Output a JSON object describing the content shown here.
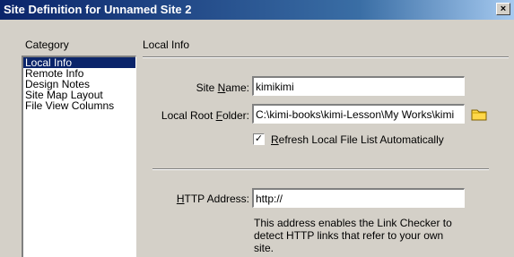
{
  "window": {
    "title": "Site Definition for Unnamed Site 2",
    "close_glyph": "×"
  },
  "category": {
    "heading": "Category",
    "items": [
      "Local Info",
      "Remote Info",
      "Design Notes",
      "Site Map Layout",
      "File View Columns"
    ],
    "selected_index": 0
  },
  "local_info": {
    "section_title": "Local Info",
    "site_name": {
      "label_pre": "Site ",
      "label_key": "N",
      "label_post": "ame:",
      "value": "kimikimi"
    },
    "local_root_folder": {
      "label_pre": "Local Root ",
      "label_key": "F",
      "label_post": "older:",
      "value": "C:\\kimi-books\\kimi-Lesson\\My Works\\kimi"
    },
    "folder_icon": "folder-icon",
    "refresh": {
      "checked": true,
      "check_glyph": "✓",
      "label_key": "R",
      "label_post": "efresh Local File List Automatically"
    },
    "http_address": {
      "label_key": "H",
      "label_post": "TTP Address:",
      "value": "http://"
    },
    "http_note": "This address enables the Link Checker to detect HTTP links that refer to your own site."
  }
}
